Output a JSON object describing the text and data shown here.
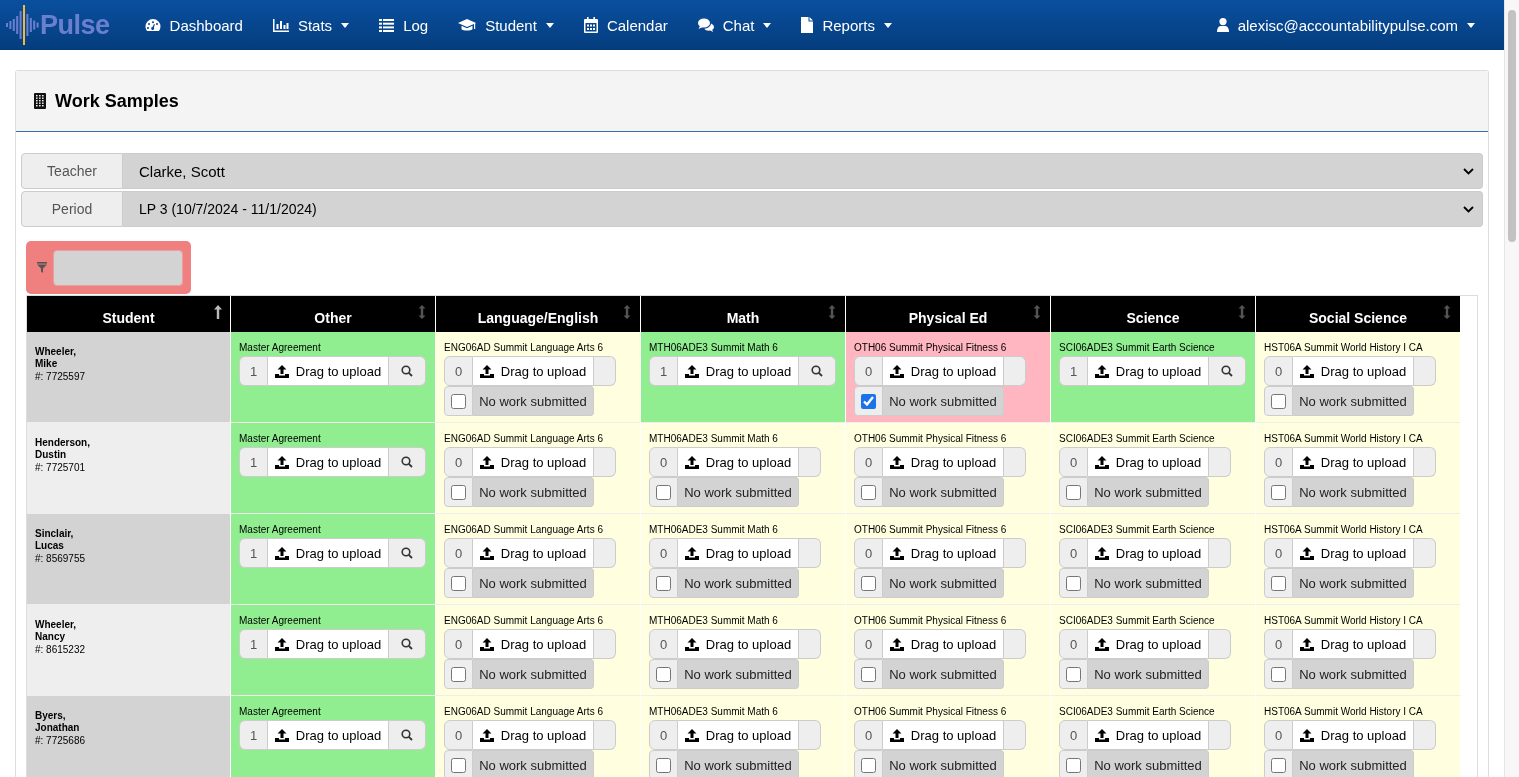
{
  "navbar": {
    "logo": "Pulse",
    "items": [
      {
        "label": "Dashboard",
        "dropdown": false
      },
      {
        "label": "Stats",
        "dropdown": true
      },
      {
        "label": "Log",
        "dropdown": false
      },
      {
        "label": "Student",
        "dropdown": true
      },
      {
        "label": "Calendar",
        "dropdown": false
      },
      {
        "label": "Chat",
        "dropdown": true
      },
      {
        "label": "Reports",
        "dropdown": true
      }
    ],
    "user": {
      "label": "alexisc@accountabilitypulse.com",
      "dropdown": true
    }
  },
  "panel": {
    "title": "Work Samples"
  },
  "filters": [
    {
      "label": "Teacher",
      "value": "Clarke, Scott"
    },
    {
      "label": "Period",
      "value": "LP 3 (10/7/2024 - 11/1/2024)"
    }
  ],
  "table": {
    "columns": [
      {
        "label": "Student",
        "sorted": true
      },
      {
        "label": "Other",
        "sorted": false
      },
      {
        "label": "Language/English",
        "sorted": false
      },
      {
        "label": "Math",
        "sorted": false
      },
      {
        "label": "Physical Ed",
        "sorted": false
      },
      {
        "label": "Science",
        "sorted": false
      },
      {
        "label": "Social Science",
        "sorted": false
      }
    ],
    "rows": [
      {
        "cells": [
          {
            "kind": "student",
            "last": "Wheeler,",
            "first": "Mike",
            "id": "#: 7725597"
          },
          {
            "kind": "submitted",
            "course": "Master Agreement",
            "count": "1",
            "upload": "Drag to upload"
          },
          {
            "kind": "open",
            "course": "ENG06AD Summit Language Arts 6",
            "count": "0",
            "upload": "Drag to upload",
            "no_work": {
              "label": "No work submitted",
              "checked": false
            }
          },
          {
            "kind": "submitted",
            "course": "MTH06ADE3 Summit Math 6",
            "count": "1",
            "upload": "Drag to upload"
          },
          {
            "kind": "open",
            "course": "OTH06 Summit Physical Fitness 6",
            "count": "0",
            "upload": "Drag to upload",
            "no_work": {
              "label": "No work submitted",
              "checked": true
            }
          },
          {
            "kind": "submitted",
            "course": "SCI06ADE3 Summit Earth Science",
            "count": "1",
            "upload": "Drag to upload"
          },
          {
            "kind": "open",
            "course": "HST06A Summit World History I CA",
            "count": "0",
            "upload": "Drag to upload",
            "no_work": {
              "label": "No work submitted",
              "checked": false
            }
          }
        ]
      },
      {
        "cells": [
          {
            "kind": "student",
            "last": "Henderson,",
            "first": "Dustin",
            "id": "#: 7725701"
          },
          {
            "kind": "submitted",
            "course": "Master Agreement",
            "count": "1",
            "upload": "Drag to upload"
          },
          {
            "kind": "open",
            "course": "ENG06AD Summit Language Arts 6",
            "count": "0",
            "upload": "Drag to upload",
            "no_work": {
              "label": "No work submitted",
              "checked": false
            }
          },
          {
            "kind": "open",
            "course": "MTH06ADE3 Summit Math 6",
            "count": "0",
            "upload": "Drag to upload",
            "no_work": {
              "label": "No work submitted",
              "checked": false
            }
          },
          {
            "kind": "open",
            "course": "OTH06 Summit Physical Fitness 6",
            "count": "0",
            "upload": "Drag to upload",
            "no_work": {
              "label": "No work submitted",
              "checked": false
            }
          },
          {
            "kind": "open",
            "course": "SCI06ADE3 Summit Earth Science",
            "count": "0",
            "upload": "Drag to upload",
            "no_work": {
              "label": "No work submitted",
              "checked": false
            }
          },
          {
            "kind": "open",
            "course": "HST06A Summit World History I CA",
            "count": "0",
            "upload": "Drag to upload",
            "no_work": {
              "label": "No work submitted",
              "checked": false
            }
          }
        ]
      },
      {
        "cells": [
          {
            "kind": "student",
            "last": "Sinclair,",
            "first": "Lucas",
            "id": "#: 8569755"
          },
          {
            "kind": "submitted",
            "course": "Master Agreement",
            "count": "1",
            "upload": "Drag to upload"
          },
          {
            "kind": "open",
            "course": "ENG06AD Summit Language Arts 6",
            "count": "0",
            "upload": "Drag to upload",
            "no_work": {
              "label": "No work submitted",
              "checked": false
            }
          },
          {
            "kind": "open",
            "course": "MTH06ADE3 Summit Math 6",
            "count": "0",
            "upload": "Drag to upload",
            "no_work": {
              "label": "No work submitted",
              "checked": false
            }
          },
          {
            "kind": "open",
            "course": "OTH06 Summit Physical Fitness 6",
            "count": "0",
            "upload": "Drag to upload",
            "no_work": {
              "label": "No work submitted",
              "checked": false
            }
          },
          {
            "kind": "open",
            "course": "SCI06ADE3 Summit Earth Science",
            "count": "0",
            "upload": "Drag to upload",
            "no_work": {
              "label": "No work submitted",
              "checked": false
            }
          },
          {
            "kind": "open",
            "course": "HST06A Summit World History I CA",
            "count": "0",
            "upload": "Drag to upload",
            "no_work": {
              "label": "No work submitted",
              "checked": false
            }
          }
        ]
      },
      {
        "cells": [
          {
            "kind": "student",
            "last": "Wheeler,",
            "first": "Nancy",
            "id": "#: 8615232"
          },
          {
            "kind": "submitted",
            "course": "Master Agreement",
            "count": "1",
            "upload": "Drag to upload"
          },
          {
            "kind": "open",
            "course": "ENG06AD Summit Language Arts 6",
            "count": "0",
            "upload": "Drag to upload",
            "no_work": {
              "label": "No work submitted",
              "checked": false
            }
          },
          {
            "kind": "open",
            "course": "MTH06ADE3 Summit Math 6",
            "count": "0",
            "upload": "Drag to upload",
            "no_work": {
              "label": "No work submitted",
              "checked": false
            }
          },
          {
            "kind": "open",
            "course": "OTH06 Summit Physical Fitness 6",
            "count": "0",
            "upload": "Drag to upload",
            "no_work": {
              "label": "No work submitted",
              "checked": false
            }
          },
          {
            "kind": "open",
            "course": "SCI06ADE3 Summit Earth Science",
            "count": "0",
            "upload": "Drag to upload",
            "no_work": {
              "label": "No work submitted",
              "checked": false
            }
          },
          {
            "kind": "open",
            "course": "HST06A Summit World History I CA",
            "count": "0",
            "upload": "Drag to upload",
            "no_work": {
              "label": "No work submitted",
              "checked": false
            }
          }
        ]
      },
      {
        "cells": [
          {
            "kind": "student",
            "last": "Byers,",
            "first": "Jonathan",
            "id": "#: 7725686"
          },
          {
            "kind": "submitted",
            "course": "Master Agreement",
            "count": "1",
            "upload": "Drag to upload"
          },
          {
            "kind": "open",
            "course": "ENG06AD Summit Language Arts 6",
            "count": "0",
            "upload": "Drag to upload",
            "no_work": {
              "label": "No work submitted",
              "checked": false
            }
          },
          {
            "kind": "open",
            "course": "MTH06ADE3 Summit Math 6",
            "count": "0",
            "upload": "Drag to upload",
            "no_work": {
              "label": "No work submitted",
              "checked": false
            }
          },
          {
            "kind": "open",
            "course": "OTH06 Summit Physical Fitness 6",
            "count": "0",
            "upload": "Drag to upload",
            "no_work": {
              "label": "No work submitted",
              "checked": false
            }
          },
          {
            "kind": "open",
            "course": "SCI06ADE3 Summit Earth Science",
            "count": "0",
            "upload": "Drag to upload",
            "no_work": {
              "label": "No work submitted",
              "checked": false
            }
          },
          {
            "kind": "open",
            "course": "HST06A Summit World History I CA",
            "count": "0",
            "upload": "Drag to upload",
            "no_work": {
              "label": "No work submitted",
              "checked": false
            }
          }
        ]
      }
    ]
  }
}
